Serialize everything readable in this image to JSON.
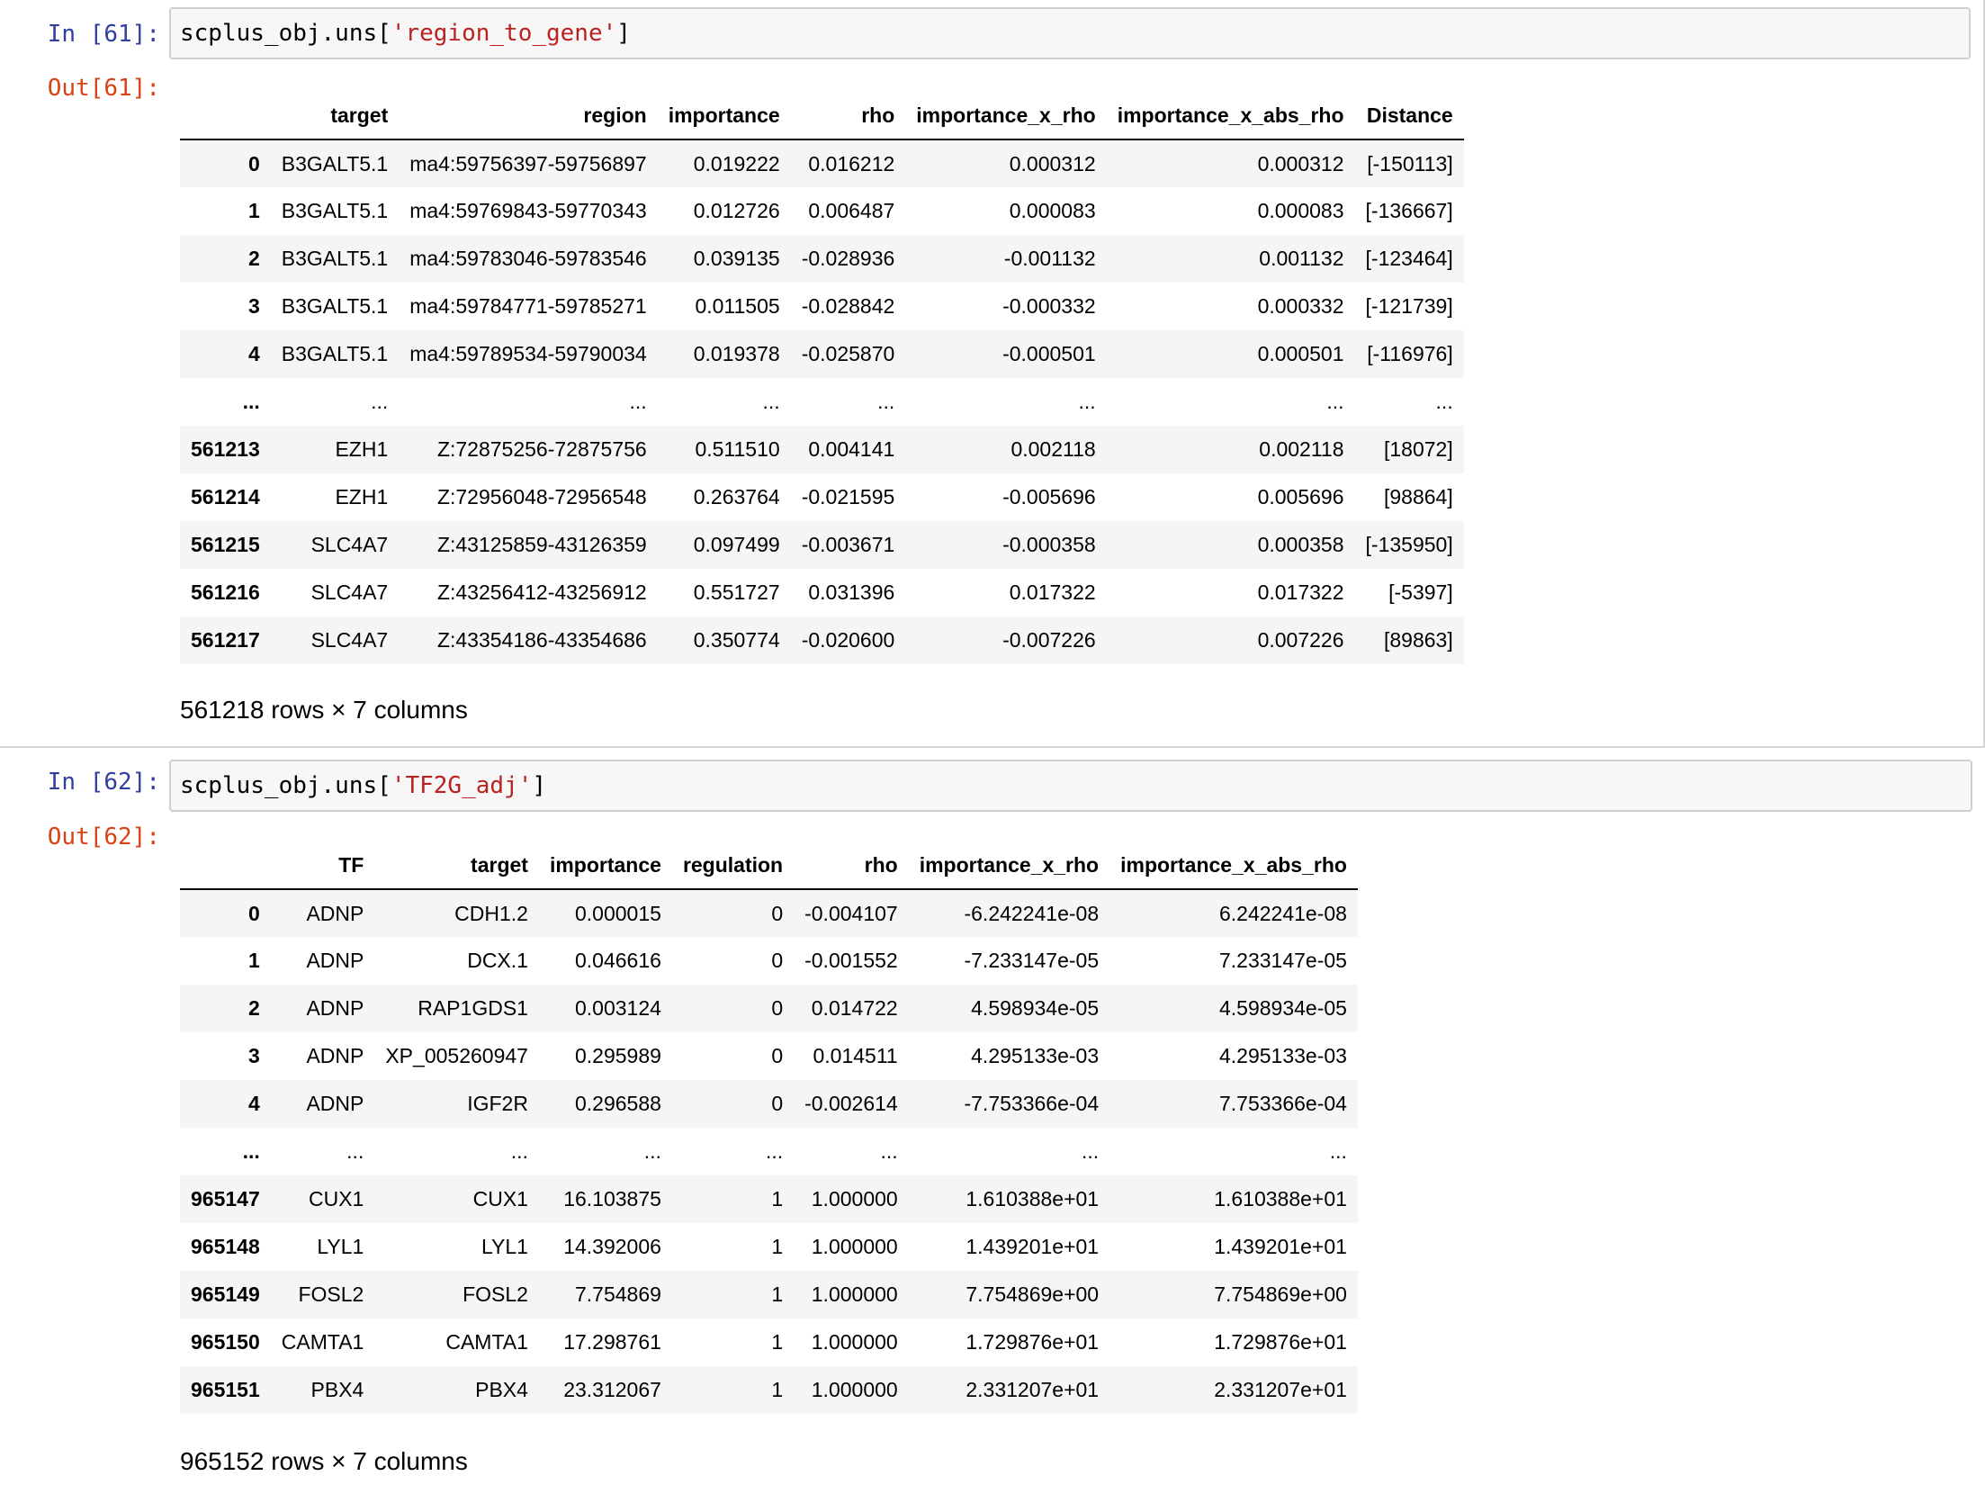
{
  "cells": [
    {
      "in_prompt": "In [61]:",
      "code_prefix": "scplus_obj.uns[",
      "code_string": "'region_to_gene'",
      "code_suffix": "]",
      "out_prompt": "Out[61]:",
      "table": {
        "columns": [
          "",
          "target",
          "region",
          "importance",
          "rho",
          "importance_x_rho",
          "importance_x_abs_rho",
          "Distance"
        ],
        "rows": [
          [
            "0",
            "B3GALT5.1",
            "ma4:59756397-59756897",
            "0.019222",
            "0.016212",
            "0.000312",
            "0.000312",
            "[-150113]"
          ],
          [
            "1",
            "B3GALT5.1",
            "ma4:59769843-59770343",
            "0.012726",
            "0.006487",
            "0.000083",
            "0.000083",
            "[-136667]"
          ],
          [
            "2",
            "B3GALT5.1",
            "ma4:59783046-59783546",
            "0.039135",
            "-0.028936",
            "-0.001132",
            "0.001132",
            "[-123464]"
          ],
          [
            "3",
            "B3GALT5.1",
            "ma4:59784771-59785271",
            "0.011505",
            "-0.028842",
            "-0.000332",
            "0.000332",
            "[-121739]"
          ],
          [
            "4",
            "B3GALT5.1",
            "ma4:59789534-59790034",
            "0.019378",
            "-0.025870",
            "-0.000501",
            "0.000501",
            "[-116976]"
          ],
          [
            "...",
            "...",
            "...",
            "...",
            "...",
            "...",
            "...",
            "..."
          ],
          [
            "561213",
            "EZH1",
            "Z:72875256-72875756",
            "0.511510",
            "0.004141",
            "0.002118",
            "0.002118",
            "[18072]"
          ],
          [
            "561214",
            "EZH1",
            "Z:72956048-72956548",
            "0.263764",
            "-0.021595",
            "-0.005696",
            "0.005696",
            "[98864]"
          ],
          [
            "561215",
            "SLC4A7",
            "Z:43125859-43126359",
            "0.097499",
            "-0.003671",
            "-0.000358",
            "0.000358",
            "[-135950]"
          ],
          [
            "561216",
            "SLC4A7",
            "Z:43256412-43256912",
            "0.551727",
            "0.031396",
            "0.017322",
            "0.017322",
            "[-5397]"
          ],
          [
            "561217",
            "SLC4A7",
            "Z:43354186-43354686",
            "0.350774",
            "-0.020600",
            "-0.007226",
            "0.007226",
            "[89863]"
          ]
        ]
      },
      "shape_text": "561218 rows × 7 columns"
    },
    {
      "in_prompt": "In [62]:",
      "code_prefix": "scplus_obj.uns[",
      "code_string": "'TF2G_adj'",
      "code_suffix": "]",
      "out_prompt": "Out[62]:",
      "table": {
        "columns": [
          "",
          "TF",
          "target",
          "importance",
          "regulation",
          "rho",
          "importance_x_rho",
          "importance_x_abs_rho"
        ],
        "rows": [
          [
            "0",
            "ADNP",
            "CDH1.2",
            "0.000015",
            "0",
            "-0.004107",
            "-6.242241e-08",
            "6.242241e-08"
          ],
          [
            "1",
            "ADNP",
            "DCX.1",
            "0.046616",
            "0",
            "-0.001552",
            "-7.233147e-05",
            "7.233147e-05"
          ],
          [
            "2",
            "ADNP",
            "RAP1GDS1",
            "0.003124",
            "0",
            "0.014722",
            "4.598934e-05",
            "4.598934e-05"
          ],
          [
            "3",
            "ADNP",
            "XP_005260947",
            "0.295989",
            "0",
            "0.014511",
            "4.295133e-03",
            "4.295133e-03"
          ],
          [
            "4",
            "ADNP",
            "IGF2R",
            "0.296588",
            "0",
            "-0.002614",
            "-7.753366e-04",
            "7.753366e-04"
          ],
          [
            "...",
            "...",
            "...",
            "...",
            "...",
            "...",
            "...",
            "..."
          ],
          [
            "965147",
            "CUX1",
            "CUX1",
            "16.103875",
            "1",
            "1.000000",
            "1.610388e+01",
            "1.610388e+01"
          ],
          [
            "965148",
            "LYL1",
            "LYL1",
            "14.392006",
            "1",
            "1.000000",
            "1.439201e+01",
            "1.439201e+01"
          ],
          [
            "965149",
            "FOSL2",
            "FOSL2",
            "7.754869",
            "1",
            "1.000000",
            "7.754869e+00",
            "7.754869e+00"
          ],
          [
            "965150",
            "CAMTA1",
            "CAMTA1",
            "17.298761",
            "1",
            "1.000000",
            "1.729876e+01",
            "1.729876e+01"
          ],
          [
            "965151",
            "PBX4",
            "PBX4",
            "23.312067",
            "1",
            "1.000000",
            "2.331207e+01",
            "2.331207e+01"
          ]
        ]
      },
      "shape_text": "965152 rows × 7 columns"
    }
  ]
}
